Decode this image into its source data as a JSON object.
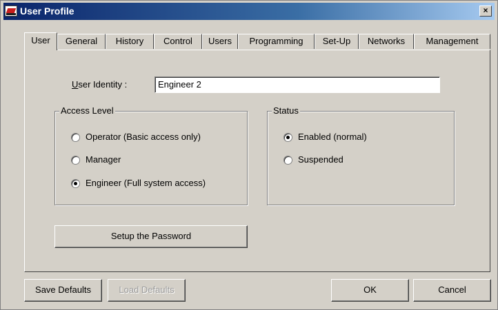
{
  "window": {
    "title": "User Profile",
    "close_glyph": "×"
  },
  "tabs": [
    {
      "label": "User",
      "active": true
    },
    {
      "label": "General"
    },
    {
      "label": "History"
    },
    {
      "label": "Control"
    },
    {
      "label": "Users"
    },
    {
      "label": "Programming"
    },
    {
      "label": "Set-Up"
    },
    {
      "label": "Networks"
    },
    {
      "label": "Management"
    }
  ],
  "user_identity": {
    "label_hotkey": "U",
    "label_rest": "ser Identity :",
    "value": "Engineer 2"
  },
  "access_level": {
    "title": "Access Level",
    "options": [
      {
        "label": "Operator (Basic access only)",
        "checked": false
      },
      {
        "label": "Manager",
        "checked": false
      },
      {
        "label": "Engineer (Full system access)",
        "checked": true
      }
    ]
  },
  "status": {
    "title": "Status",
    "options": [
      {
        "label": "Enabled (normal)",
        "checked": true
      },
      {
        "label": "Suspended",
        "checked": false
      }
    ]
  },
  "buttons": {
    "setup_password": "Setup the Password",
    "save_defaults": "Save Defaults",
    "load_defaults": "Load Defaults",
    "ok": "OK",
    "cancel": "Cancel"
  }
}
